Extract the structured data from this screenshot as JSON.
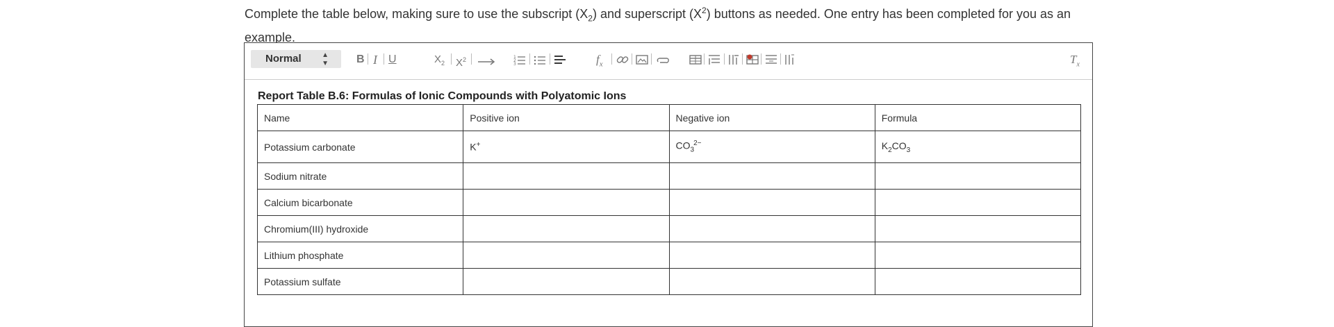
{
  "prompt": {
    "text_before_sub": "Complete the table below, making sure to use the subscript (X",
    "sub_digit": "2",
    "text_mid": ") and superscript (X",
    "sup_digit": "2",
    "text_after": ") buttons as needed. One entry has been completed for you as an example."
  },
  "toolbar": {
    "format_value": "Normal",
    "buttons": [
      "bold",
      "italic",
      "underline",
      "subscript",
      "superscript",
      "arrow",
      "ordered-list",
      "bullet-list",
      "align",
      "formula",
      "link",
      "image",
      "attachment",
      "table",
      "table-row",
      "table-column",
      "table-delete",
      "table-row-insert",
      "table-column-insert",
      "clear-format"
    ]
  },
  "table": {
    "title": "Report Table B.6: Formulas of Ionic Compounds with Polyatomic Ions",
    "headers": [
      "Name",
      "Positive ion",
      "Negative ion",
      "Formula"
    ],
    "example": {
      "name": "Potassium carbonate",
      "pos_base": "K",
      "pos_sup": "+",
      "neg_base": "CO",
      "neg_sub": "3",
      "neg_sup": "2−",
      "formula_k": "K",
      "formula_k_sub": "2",
      "formula_co": "CO",
      "formula_co_sub": "3"
    },
    "rows": [
      "Sodium nitrate",
      "Calcium bicarbonate",
      "Chromium(III) hydroxide",
      "Lithium phosphate",
      "Potassium sulfate"
    ]
  }
}
